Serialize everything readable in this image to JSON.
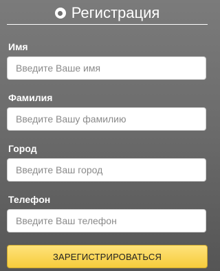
{
  "header": {
    "title": "Регистрация",
    "icon": "registered-icon"
  },
  "fields": [
    {
      "label": "Имя",
      "placeholder": "Введите Ваше имя"
    },
    {
      "label": "Фамилия",
      "placeholder": "Введите Вашу фамилию"
    },
    {
      "label": "Город",
      "placeholder": "Введите Ваш город"
    },
    {
      "label": "Телефон",
      "placeholder": "Введите Ваш телефон"
    }
  ],
  "submit_label": "ЗАРЕГИСТРИРОВАТЬСЯ",
  "colors": {
    "button": "#f6cc3c",
    "background": "#6c6c6c"
  }
}
